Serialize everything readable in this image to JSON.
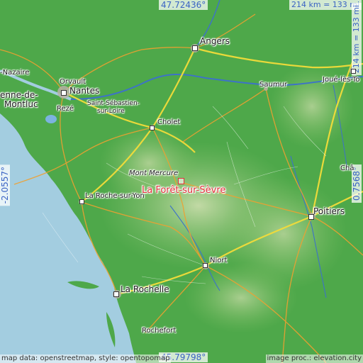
{
  "coords": {
    "top": "47.72436°",
    "bottom": "45.79798°",
    "left": "-2.0557°",
    "right": "0.7568°"
  },
  "scale": {
    "horizontal": "214 km = 133 mi",
    "vertical": "214 km = 133 mi"
  },
  "target": {
    "name": "La Forêt-sur-Sèvre",
    "marker_color": "#e0303a"
  },
  "places": {
    "angers": "Angers",
    "saint_nazaire": "-Nazaire",
    "orvault": "Orvault",
    "nantes": "Nantes",
    "saint_herblain": "enne-de-",
    "montluc": "Montluc",
    "reze": "Rezé",
    "saint_sebastien_1": "Saint-Sébastien-",
    "saint_sebastien_2": "sur-Loire",
    "saumur": "Saumur",
    "joue_les_tours": "Joué-lès-To",
    "cholet": "Cholet",
    "mont_mercure": "Mont Mercure",
    "la_roche": "La Roche-sur-Yon",
    "chatellerault": "Châ",
    "poitiers": "Poitiers",
    "niort": "Niort",
    "la_rochelle": "La Rochelle",
    "rochefort": "Rochefort"
  },
  "credits": {
    "left": "map data: openstreetmap, style: opentopomap",
    "right": "image proc.: elevation.city"
  },
  "colors": {
    "sea": "#a3cde0",
    "lowland": "#4ea84a",
    "upland": "#a8cc8c",
    "roads": "#f0a030",
    "motorway": "#f2dc3a",
    "rivers": "#3d72c8"
  }
}
